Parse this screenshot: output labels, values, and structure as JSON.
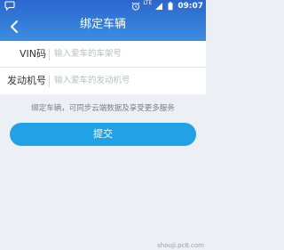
{
  "status_bar": {
    "time": "09:07",
    "network_label": "LTE"
  },
  "header": {
    "title": "绑定车辆"
  },
  "form": {
    "vin": {
      "label": "VIN码",
      "placeholder": "输入爱车的车架号"
    },
    "engine": {
      "label": "发动机号",
      "placeholder": "输入爱车的发动机号"
    }
  },
  "hint": "绑定车辆，可同步云端数据及享受更多服务",
  "submit_label": "提交",
  "watermark": "shouji.pc6.com",
  "colors": {
    "header_top": "#2b66cf",
    "header_bottom": "#3b8ee0",
    "submit": "#21a2e7",
    "background": "#eceff3"
  },
  "icons": [
    "back-arrow-icon",
    "chat-icon",
    "alarm-clock-icon",
    "signal-icon",
    "battery-icon"
  ]
}
